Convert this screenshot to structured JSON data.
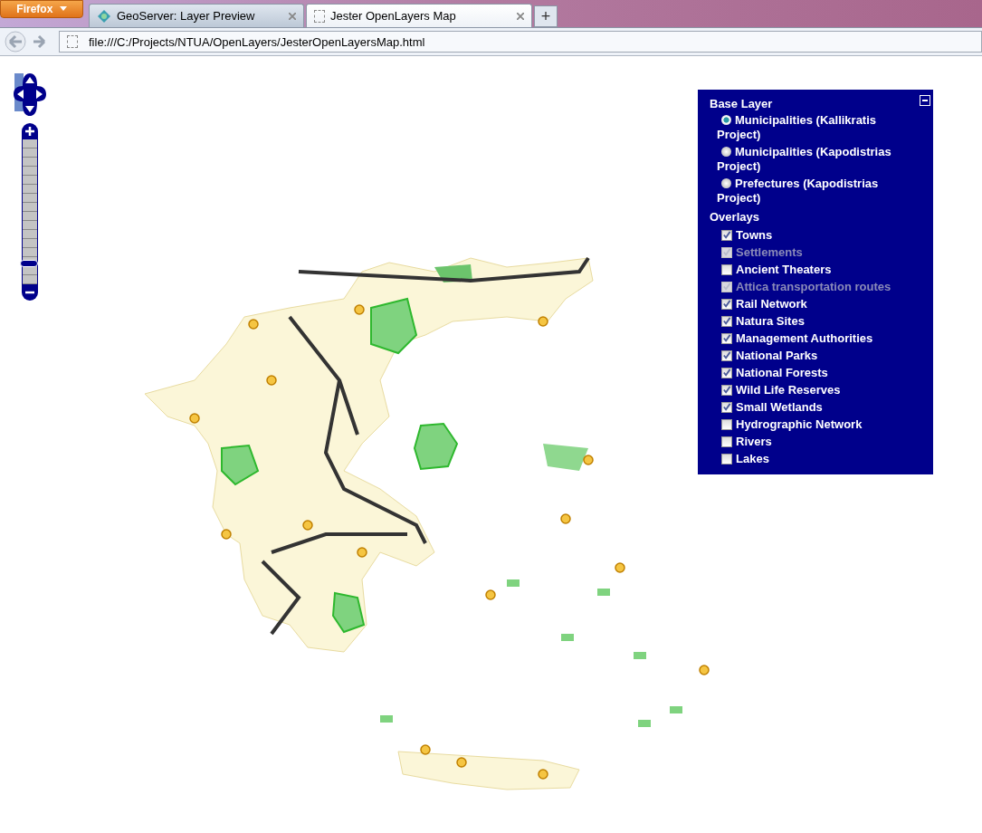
{
  "browser": {
    "menu_button": "Firefox",
    "tabs": [
      {
        "title": "GeoServer: Layer Preview",
        "selected": false
      },
      {
        "title": "Jester OpenLayers Map",
        "selected": true
      }
    ],
    "new_tab": "+",
    "address": "file:///C:/Projects/NTUA/OpenLayers/JesterOpenLayersMap.html"
  },
  "map": {
    "zoom": {
      "level": 0.12
    },
    "layer_switcher": {
      "base_title": "Base Layer",
      "base_layers": [
        {
          "label": "Municipalities (Kallikratis Project)",
          "selected": true
        },
        {
          "label": "Municipalities (Kapodistrias Project)",
          "selected": false
        },
        {
          "label": "Prefectures (Kapodistrias Project)",
          "selected": false
        }
      ],
      "overlays_title": "Overlays",
      "overlays": [
        {
          "label": "Towns",
          "checked": true,
          "disabled": false
        },
        {
          "label": "Settlements",
          "checked": true,
          "disabled": true
        },
        {
          "label": "Ancient Theaters",
          "checked": false,
          "disabled": false
        },
        {
          "label": "Attica transportation routes",
          "checked": true,
          "disabled": true
        },
        {
          "label": "Rail Network",
          "checked": true,
          "disabled": false
        },
        {
          "label": "Natura Sites",
          "checked": true,
          "disabled": false
        },
        {
          "label": "Management Authorities",
          "checked": true,
          "disabled": false
        },
        {
          "label": "National Parks",
          "checked": true,
          "disabled": false
        },
        {
          "label": "National Forests",
          "checked": true,
          "disabled": false
        },
        {
          "label": "Wild Life Reserves",
          "checked": true,
          "disabled": false
        },
        {
          "label": "Small Wetlands",
          "checked": true,
          "disabled": false
        },
        {
          "label": "Hydrographic Network",
          "checked": false,
          "disabled": false
        },
        {
          "label": "Rivers",
          "checked": false,
          "disabled": false
        },
        {
          "label": "Lakes",
          "checked": false,
          "disabled": false
        }
      ]
    }
  }
}
